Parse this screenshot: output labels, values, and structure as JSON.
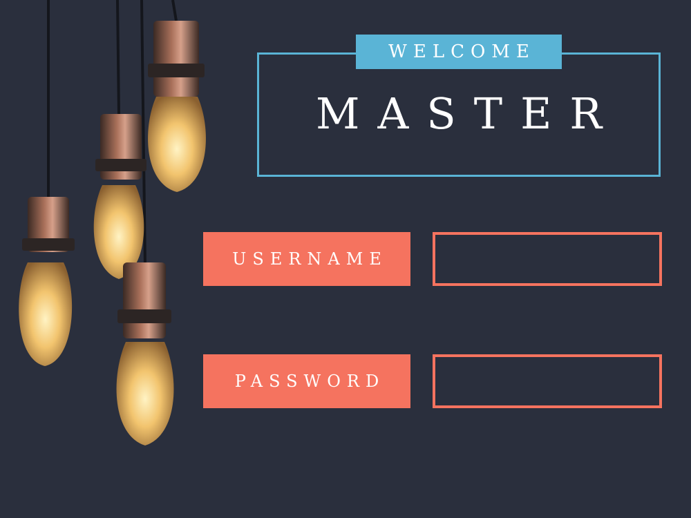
{
  "header": {
    "welcome_label": "WELCOME",
    "title": "MASTER"
  },
  "login": {
    "username_label": "USERNAME",
    "username_value": "",
    "password_label": "PASSWORD",
    "password_value": ""
  },
  "colors": {
    "background": "#2a2f3d",
    "accent_blue": "#5ab4d6",
    "accent_coral": "#f5735f"
  },
  "decor": {
    "illustration": "hanging-edison-bulbs"
  }
}
